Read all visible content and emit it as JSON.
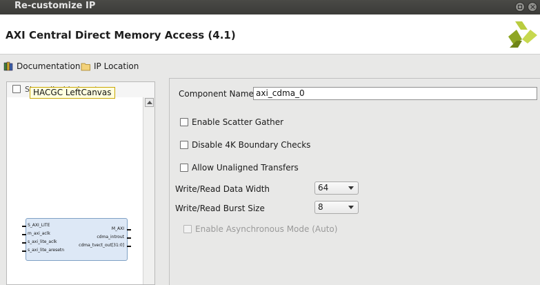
{
  "window": {
    "title": "Re-customize IP"
  },
  "header": {
    "ip_title": "AXI Central Direct Memory Access (4.1)"
  },
  "toolbar": {
    "documentation": "Documentation",
    "ip_location": "IP Location"
  },
  "left_panel": {
    "show_disabled_ports_label": "Show disabled ports",
    "tooltip": "HACGC LeftCanvas",
    "block": {
      "left_ports": [
        "S_AXI_LITE",
        "m_axi_aclk",
        "s_axi_lite_aclk",
        "s_axi_lite_aresetn"
      ],
      "right_ports": [
        "M_AXI",
        "cdma_introut",
        "cdma_tvect_out[31:0]"
      ]
    }
  },
  "form": {
    "component_name_label": "Component Name",
    "component_name_value": "axi_cdma_0",
    "enable_scatter_gather": "Enable Scatter Gather",
    "disable_4k_boundary": "Disable 4K Boundary Checks",
    "allow_unaligned": "Allow Unaligned Transfers",
    "data_width_label": "Write/Read Data Width",
    "data_width_value": "64",
    "burst_size_label": "Write/Read Burst Size",
    "burst_size_value": "8",
    "async_mode": "Enable Asynchronous Mode (Auto)"
  },
  "icons": {
    "documentation": "books-icon",
    "ip_location": "folder-icon",
    "logo": "xilinx-logo"
  },
  "colors": {
    "title_bar": "#3f3f3c",
    "logo": "#9fb52a",
    "block_fill": "#dde8f6"
  }
}
